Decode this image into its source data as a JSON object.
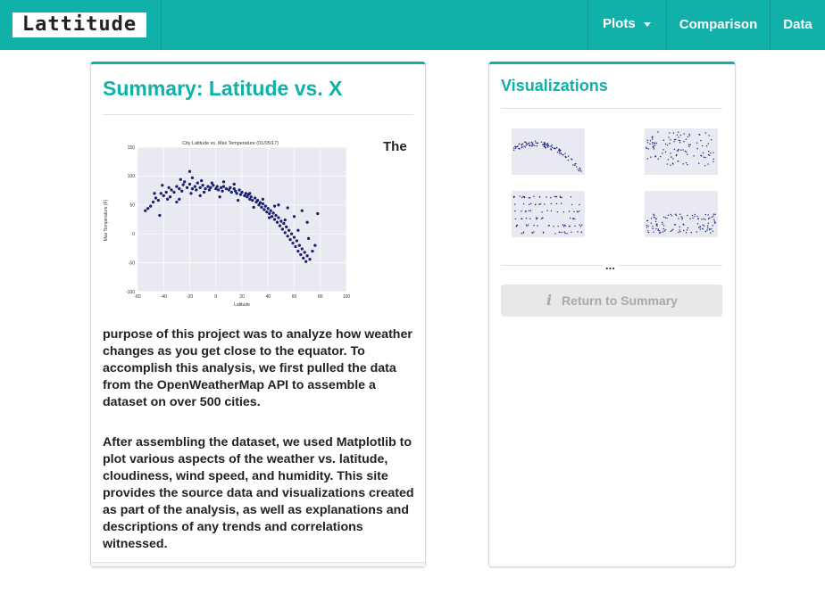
{
  "navbar": {
    "brand": "Lattitude",
    "plots_label": "Plots",
    "comparison_label": "Comparison",
    "data_label": "Data",
    "colors": {
      "background": "#11b0a8",
      "text": "#ffffff"
    }
  },
  "summary": {
    "title": "Summary: Latitude vs. X",
    "lead_word": "The",
    "paragraph1": "purpose of this project was to analyze how weather changes as you get close to the equator. To accomplish this analysis, we first pulled the data from the OpenWeatherMap API to assemble a dataset on over 500 cities.",
    "paragraph2": "After assembling the dataset, we used Matplotlib to plot various aspects of the weather vs. latitude, cloudiness, wind speed, and humidity. This site provides the source data and visualizations created as part of the analysis, as well as explanations and descriptions of any trends and correlations witnessed."
  },
  "visualizations": {
    "title": "Visualizations",
    "ellipsis": "...",
    "return_label": "Return to Summary",
    "info_icon": "info-icon",
    "thumbnail_count": 4
  },
  "chart_data": {
    "type": "scatter",
    "title": "City Latitude vs. Max Temperature (01/05/17)",
    "xlabel": "Latitude",
    "ylabel": "Max Temperature (F)",
    "xlim": [
      -60,
      100
    ],
    "ylim": [
      -100,
      150
    ],
    "xticks": [
      "-60",
      "-40",
      "-20",
      "0",
      "20",
      "40",
      "60",
      "80",
      "100"
    ],
    "yticks": [
      "150",
      "100",
      "50",
      "0",
      "-50",
      "-100"
    ],
    "point_color": "#1a237e",
    "points": [
      [
        -54,
        40
      ],
      [
        -52,
        44
      ],
      [
        -50,
        48
      ],
      [
        -48,
        55
      ],
      [
        -46,
        62
      ],
      [
        -44,
        58
      ],
      [
        -42,
        70
      ],
      [
        -40,
        66
      ],
      [
        -38,
        72
      ],
      [
        -36,
        80
      ],
      [
        -35,
        64
      ],
      [
        -34,
        76
      ],
      [
        -32,
        72
      ],
      [
        -30,
        82
      ],
      [
        -28,
        78
      ],
      [
        -26,
        74
      ],
      [
        -25,
        85
      ],
      [
        -24,
        90
      ],
      [
        -22,
        80
      ],
      [
        -20,
        86
      ],
      [
        -19,
        70
      ],
      [
        -18,
        78
      ],
      [
        -16,
        82
      ],
      [
        -15,
        76
      ],
      [
        -14,
        88
      ],
      [
        -12,
        80
      ],
      [
        -10,
        84
      ],
      [
        -9,
        72
      ],
      [
        -8,
        78
      ],
      [
        -6,
        82
      ],
      [
        -5,
        76
      ],
      [
        -4,
        80
      ],
      [
        -2,
        84
      ],
      [
        0,
        78
      ],
      [
        1,
        82
      ],
      [
        2,
        76
      ],
      [
        4,
        80
      ],
      [
        5,
        74
      ],
      [
        6,
        82
      ],
      [
        8,
        78
      ],
      [
        10,
        76
      ],
      [
        11,
        80
      ],
      [
        12,
        72
      ],
      [
        14,
        78
      ],
      [
        15,
        74
      ],
      [
        16,
        70
      ],
      [
        18,
        76
      ],
      [
        19,
        68
      ],
      [
        20,
        72
      ],
      [
        22,
        66
      ],
      [
        23,
        70
      ],
      [
        24,
        64
      ],
      [
        25,
        68
      ],
      [
        26,
        60
      ],
      [
        27,
        64
      ],
      [
        28,
        58
      ],
      [
        30,
        62
      ],
      [
        31,
        55
      ],
      [
        32,
        58
      ],
      [
        33,
        50
      ],
      [
        34,
        54
      ],
      [
        35,
        46
      ],
      [
        36,
        52
      ],
      [
        37,
        42
      ],
      [
        38,
        48
      ],
      [
        39,
        38
      ],
      [
        40,
        44
      ],
      [
        41,
        35
      ],
      [
        42,
        40
      ],
      [
        43,
        30
      ],
      [
        44,
        36
      ],
      [
        45,
        25
      ],
      [
        46,
        32
      ],
      [
        47,
        20
      ],
      [
        48,
        28
      ],
      [
        49,
        14
      ],
      [
        50,
        22
      ],
      [
        51,
        8
      ],
      [
        52,
        18
      ],
      [
        53,
        2
      ],
      [
        54,
        12
      ],
      [
        55,
        -4
      ],
      [
        56,
        6
      ],
      [
        57,
        -10
      ],
      [
        58,
        0
      ],
      [
        59,
        -16
      ],
      [
        60,
        -6
      ],
      [
        61,
        -22
      ],
      [
        62,
        -12
      ],
      [
        63,
        -30
      ],
      [
        64,
        -20
      ],
      [
        65,
        -36
      ],
      [
        66,
        -26
      ],
      [
        67,
        -42
      ],
      [
        68,
        -32
      ],
      [
        69,
        -48
      ],
      [
        70,
        -38
      ],
      [
        72,
        -44
      ],
      [
        74,
        -30
      ],
      [
        76,
        -20
      ],
      [
        -43,
        32
      ],
      [
        -28,
        60
      ],
      [
        -12,
        66
      ],
      [
        3,
        64
      ],
      [
        17,
        58
      ],
      [
        29,
        46
      ],
      [
        41,
        28
      ],
      [
        53,
        24
      ],
      [
        63,
        6
      ],
      [
        71,
        -8
      ],
      [
        -20,
        108
      ],
      [
        -18,
        97
      ],
      [
        -30,
        55
      ],
      [
        45,
        48
      ],
      [
        60,
        30
      ],
      [
        70,
        20
      ],
      [
        78,
        35
      ],
      [
        66,
        40
      ],
      [
        55,
        45
      ],
      [
        48,
        50
      ],
      [
        36,
        60
      ],
      [
        26,
        70
      ],
      [
        14,
        86
      ],
      [
        6,
        90
      ],
      [
        -3,
        88
      ],
      [
        -11,
        92
      ],
      [
        -27,
        94
      ],
      [
        -41,
        84
      ],
      [
        -47,
        70
      ],
      [
        -37,
        60
      ]
    ]
  }
}
